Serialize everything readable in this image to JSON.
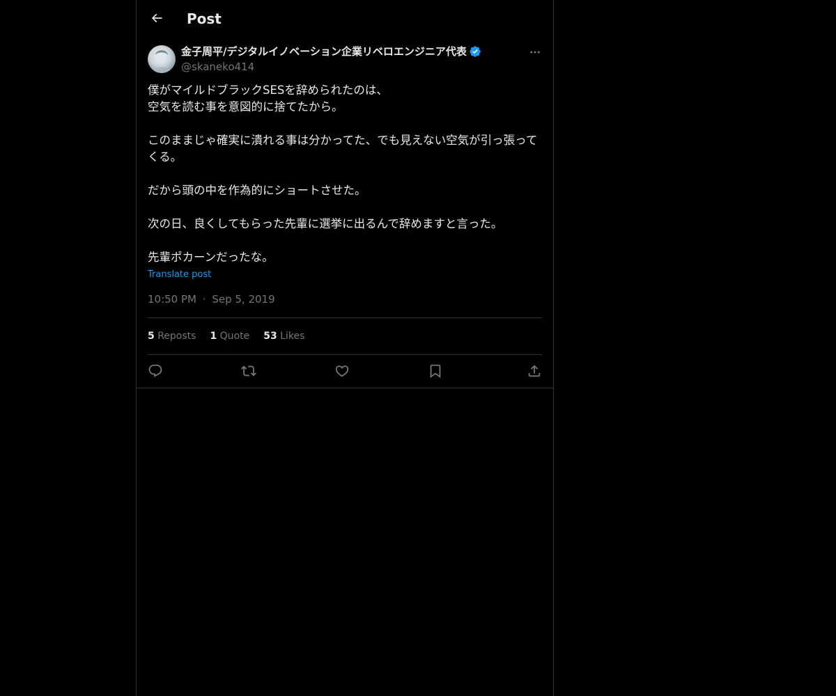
{
  "header": {
    "title": "Post"
  },
  "author": {
    "display_name": "金子周平/デジタルイノベーション企業リベロエンジニア代表",
    "handle": "@skaneko414",
    "verified": true
  },
  "post": {
    "paragraphs": [
      "僕がマイルドブラックSESを辞められたのは、\n空気を読む事を意図的に捨てたから。",
      "このままじゃ確実に潰れる事は分かってた、でも見えない空気が引っ張ってくる。",
      "だから頭の中を作為的にショートさせた。",
      "次の日、良くしてもらった先輩に選挙に出るんで辞めますと言った。",
      "先輩ポカーンだったな。"
    ],
    "translate_label": "Translate post",
    "time": "10:50 PM",
    "separator": "·",
    "date": "Sep 5, 2019"
  },
  "stats": {
    "reposts_count": "5",
    "reposts_label": "Reposts",
    "quotes_count": "1",
    "quotes_label": "Quote",
    "likes_count": "53",
    "likes_label": "Likes"
  },
  "actions": [
    "reply-icon",
    "repost-icon",
    "like-icon",
    "bookmark-icon",
    "share-icon"
  ],
  "colors": {
    "background": "#000000",
    "text": "#e7e9ea",
    "muted": "#71767b",
    "accent": "#1d9bf0",
    "border": "#2f3336"
  }
}
